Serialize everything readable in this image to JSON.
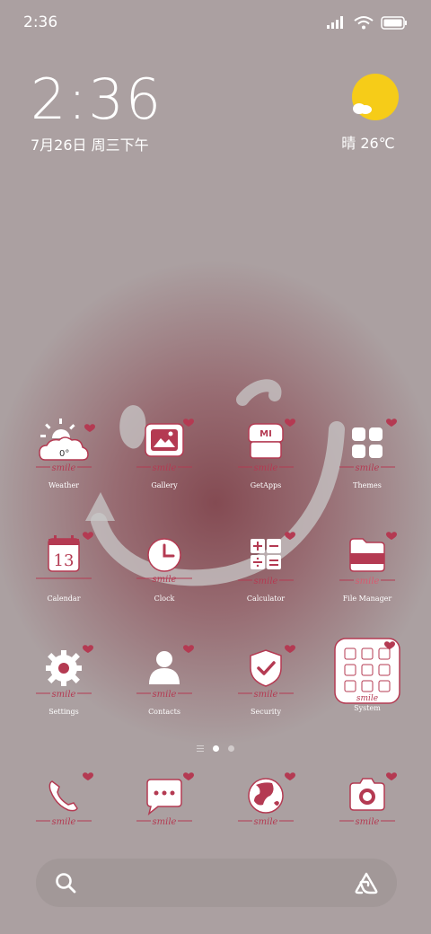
{
  "status_bar": {
    "time": "2:36",
    "icons": [
      "signal-icon",
      "wifi-icon",
      "battery-icon"
    ]
  },
  "clock_widget": {
    "time": "2:36",
    "date": "7月26日 周三下午"
  },
  "weather_widget": {
    "text": "晴 26℃",
    "icon": "sunny-icon"
  },
  "apps": {
    "row1": [
      {
        "label": "Weather",
        "icon": "weather-icon"
      },
      {
        "label": "Gallery",
        "icon": "gallery-icon"
      },
      {
        "label": "GetApps",
        "icon": "getapps-icon"
      },
      {
        "label": "Themes",
        "icon": "themes-icon"
      }
    ],
    "row2": [
      {
        "label": "Calendar",
        "icon": "calendar-icon",
        "day": "13"
      },
      {
        "label": "Clock",
        "icon": "clock-icon"
      },
      {
        "label": "Calculator",
        "icon": "calculator-icon"
      },
      {
        "label": "File Manager",
        "icon": "file-manager-icon"
      }
    ],
    "row3": [
      {
        "label": "Settings",
        "icon": "settings-icon"
      },
      {
        "label": "Contacts",
        "icon": "contacts-icon"
      },
      {
        "label": "Security",
        "icon": "security-icon"
      },
      {
        "label": "System",
        "icon": "system-folder-icon"
      }
    ]
  },
  "weather_app_temp": "0°",
  "decoration_text": "smile",
  "page_indicator": {
    "pages": 2,
    "current": 1
  },
  "dock": [
    {
      "icon": "phone-icon"
    },
    {
      "icon": "messages-icon"
    },
    {
      "icon": "browser-icon"
    },
    {
      "icon": "camera-icon"
    }
  ],
  "search_bar": {
    "left_icon": "search-icon",
    "right_icon": "assistant-icon"
  },
  "colors": {
    "accent": "#b43a52",
    "heart": "#b43a52",
    "weather_sun": "#f6cc18"
  }
}
